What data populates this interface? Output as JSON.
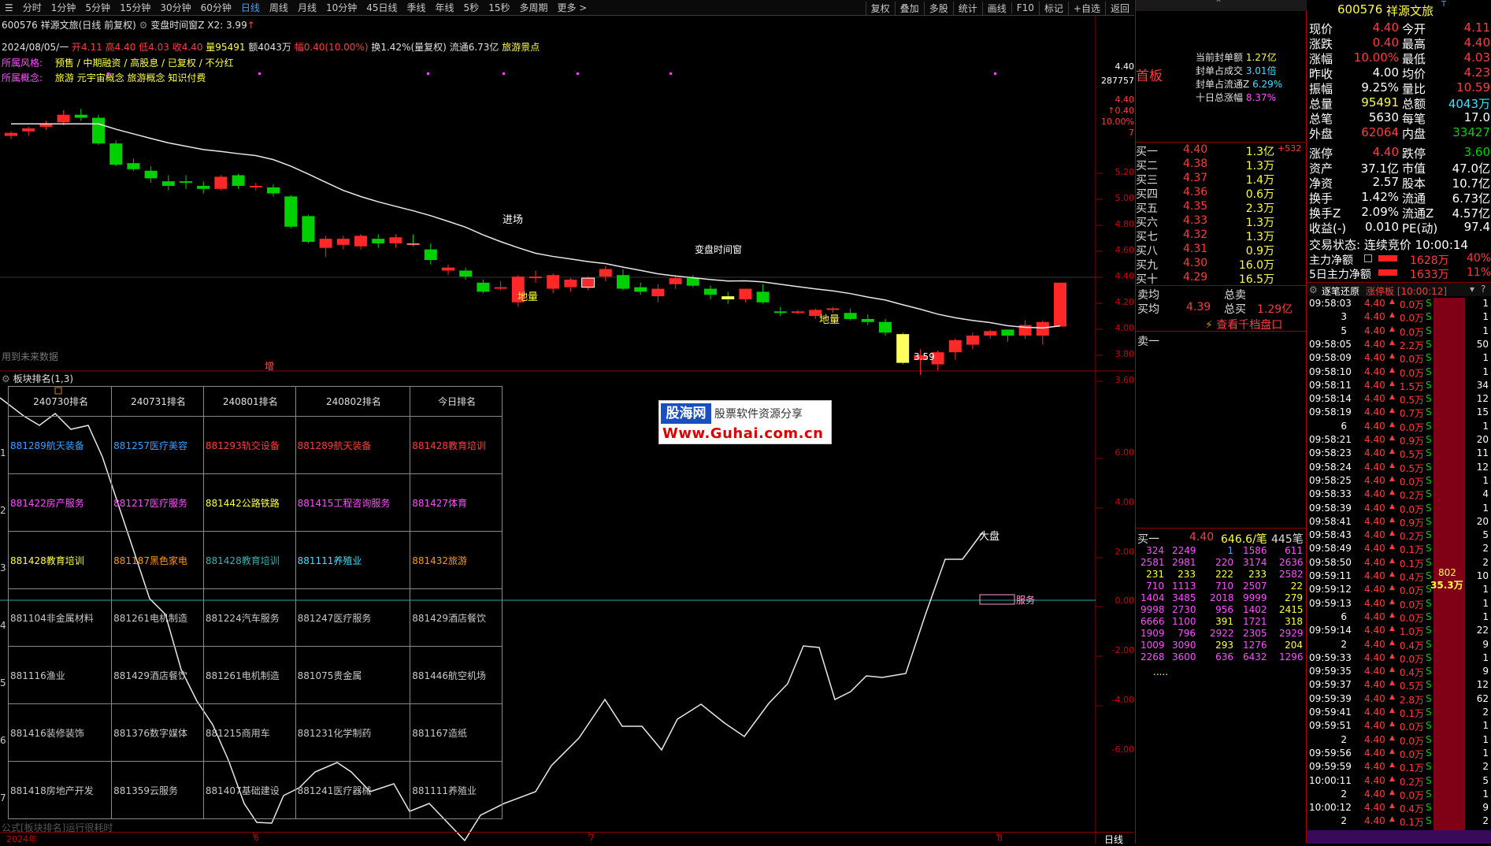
{
  "toolbar": {
    "left": [
      "☰",
      "分时",
      "1分钟",
      "5分钟",
      "15分钟",
      "30分钟",
      "60分钟",
      "日线",
      "周线",
      "月线",
      "10分钟",
      "45日线",
      "季线",
      "年线",
      "5秒",
      "15秒",
      "多周期",
      "更多 >"
    ],
    "right": [
      "复权",
      "叠加",
      "多股",
      "统计",
      "画线",
      "F10",
      "标记",
      "+自选",
      "返回"
    ]
  },
  "chart_title": "600576 祥源文旅(日线 前复权)",
  "indicator_title": "变盘时间窗Z X2: 3.99",
  "info": {
    "date": "2024/08/05/一",
    "open": "开4.11",
    "high": "高4.40",
    "low": "低4.03",
    "close": "收4.40",
    "volume": "量95491",
    "amount": "额4043万",
    "change": "幅0.40(10.00%)",
    "turnover": "换1.42%(量复权)",
    "float": "流通6.73亿",
    "concept_tag": "旅游景点"
  },
  "style_label": "所属风格:",
  "style_value": "预售 / 中期融资 / 高股息 / 已复权 / 不分红",
  "concept_label": "所属概念:",
  "concept_value": "旅游 元宇宙概念 旅游概念 知识付费",
  "main_labels": {
    "entry": "进场",
    "bottom1": "地量",
    "bottom2": "地量",
    "window": "变盘时间窗",
    "low": "3.59",
    "future": "用到未来数据",
    "add": "增"
  },
  "main_axis": [
    "4.40",
    "287757",
    "4.40",
    "↑0.40",
    "10.00%",
    "7",
    "5.20",
    "5.00",
    "4.80",
    "4.60",
    "4.40",
    "4.20",
    "4.00",
    "3.80",
    "3.60"
  ],
  "sub_title": "板块排名(1,3)",
  "watermark": {
    "line1": "股海网",
    "line2": "股票软件资源分享",
    "url": "Www.Guhai.com.cn"
  },
  "ranking": {
    "headers": [
      "240730排名",
      "240731排名",
      "240801排名",
      "240802排名",
      "今日排名"
    ],
    "rows": [
      [
        "881289航天装备",
        "881257医疗美容",
        "881293轨交设备",
        "881289航天装备",
        "881428教育培训"
      ],
      [
        "881422房产服务",
        "881217医疗服务",
        "881442公路铁路",
        "881415工程咨询服务",
        "881427体育"
      ],
      [
        "881428教育培训",
        "881187黑色家电",
        "881428教育培训",
        "881111养殖业",
        "881432旅游"
      ],
      [
        "881104非金属材料",
        "881261电机制造",
        "881224汽车服务",
        "881247医疗服务",
        "881429酒店餐饮"
      ],
      [
        "881116渔业",
        "881429酒店餐饮",
        "881261电机制造",
        "881075贵金属",
        "881446航空机场"
      ],
      [
        "881416装修装饰",
        "881376数字媒体",
        "881215商用车",
        "881231化学制药",
        "881167造纸"
      ],
      [
        "881418房地产开发",
        "881359云服务",
        "881407基础建设",
        "881241医疗器械",
        "881111养殖业"
      ]
    ]
  },
  "sub_axis": [
    "6.00",
    "4.00",
    "2.00",
    "0.00",
    "-2.00",
    "-4.00",
    "-6.00"
  ],
  "sub_labels": {
    "dapan": "大盘",
    "service": "服务",
    "formula": "公式[板块排名]运行很耗时"
  },
  "xaxis": {
    "year": "2024年",
    "m6": "6",
    "m7": "7",
    "m8": "8",
    "period": "日线"
  },
  "quote": {
    "code": "600576",
    "name": "祥源文旅",
    "pairs": [
      [
        "现价",
        "4.40",
        "今开",
        "4.11"
      ],
      [
        "涨跌",
        "0.40",
        "最高",
        "4.40"
      ],
      [
        "涨幅",
        "10.00%",
        "最低",
        "4.03"
      ],
      [
        "昨收",
        "4.00",
        "均价",
        "4.23"
      ],
      [
        "振幅",
        "9.25%",
        "量比",
        "10.59"
      ],
      [
        "总量",
        "95491",
        "总额",
        "4043万"
      ],
      [
        "总笔",
        "5630",
        "每笔",
        "17.0"
      ],
      [
        "外盘",
        "62064",
        "内盘",
        "33427"
      ],
      [
        "涨停",
        "4.40",
        "跌停",
        "3.60"
      ],
      [
        "资产",
        "37.1亿",
        "市值",
        "47.0亿"
      ],
      [
        "净资",
        "2.57",
        "股本",
        "10.7亿"
      ],
      [
        "换手",
        "1.42%",
        "流通",
        "6.73亿"
      ],
      [
        "换手Z",
        "2.09%",
        "流通Z",
        "4.57亿"
      ],
      [
        "收益(-)",
        "0.010",
        "PE(动)",
        "97.4"
      ]
    ],
    "trade_status": "交易状态: 连续竞价 10:00:14",
    "main_net": [
      "主力净额",
      "1628万",
      "40%"
    ],
    "main_net5": [
      "5日主力净额",
      "1633万",
      "11%"
    ]
  },
  "board": {
    "title": "首板",
    "items": [
      [
        "当前封单额",
        "1.27亿"
      ],
      [
        "封单占成交",
        "3.01倍"
      ],
      [
        "封单占流通Z",
        "6.29%"
      ],
      [
        "十日总涨幅",
        "8.37%"
      ]
    ]
  },
  "bids": [
    [
      "买一",
      "4.40",
      "1.3亿",
      "+532"
    ],
    [
      "买二",
      "4.38",
      "1.3万",
      ""
    ],
    [
      "买三",
      "4.37",
      "1.4万",
      ""
    ],
    [
      "买四",
      "4.36",
      "0.6万",
      ""
    ],
    [
      "买五",
      "4.35",
      "2.3万",
      ""
    ],
    [
      "买六",
      "4.33",
      "1.3万",
      ""
    ],
    [
      "买七",
      "4.32",
      "1.3万",
      ""
    ],
    [
      "买八",
      "4.31",
      "0.9万",
      ""
    ],
    [
      "买九",
      "4.30",
      "16.0万",
      ""
    ],
    [
      "买十",
      "4.29",
      "16.5万",
      ""
    ]
  ],
  "avg": {
    "sell_avg": "卖均",
    "total_sell": "总卖",
    "buy_avg": "买均",
    "buy_avg_val": "4.39",
    "total_buy": "总买",
    "total_buy_val": "1.29亿",
    "view_depth": "查看千档盘口",
    "sell1": "卖一"
  },
  "queue": {
    "head": [
      "买一",
      "4.40",
      "646.6/笔",
      "445笔"
    ],
    "rows": [
      [
        "324",
        "2249",
        "1",
        "1586",
        "611"
      ],
      [
        "2581",
        "2981",
        "220",
        "3174",
        "2636"
      ],
      [
        "231",
        "233",
        "222",
        "233",
        "2582"
      ],
      [
        "710",
        "1113",
        "710",
        "2507",
        "22"
      ],
      [
        "1404",
        "3485",
        "2018",
        "9999",
        "279"
      ],
      [
        "9998",
        "2730",
        "956",
        "1402",
        "2415"
      ],
      [
        "6666",
        "1100",
        "391",
        "1721",
        "318"
      ],
      [
        "1909",
        "796",
        "2922",
        "2305",
        "2929"
      ],
      [
        "1009",
        "3090",
        "293",
        "1276",
        "204"
      ],
      [
        "2268",
        "3600",
        "636",
        "6432",
        "1296"
      ]
    ],
    "more": "....."
  },
  "ticks_title": "逐笔还原",
  "ticks_tab": "涨停板 [10:00:12]",
  "ticks": [
    [
      "09:58:03",
      "4.40",
      "0.0万",
      "S",
      "1"
    ],
    [
      "3",
      "4.40",
      "0.0万",
      "S",
      "1"
    ],
    [
      "5",
      "4.40",
      "0.0万",
      "S",
      "1"
    ],
    [
      "09:58:05",
      "4.40",
      "2.2万",
      "S",
      "50"
    ],
    [
      "09:58:09",
      "4.40",
      "0.0万",
      "S",
      "1"
    ],
    [
      "09:58:10",
      "4.40",
      "0.0万",
      "S",
      "1"
    ],
    [
      "09:58:11",
      "4.40",
      "1.5万",
      "S",
      "34"
    ],
    [
      "09:58:14",
      "4.40",
      "0.5万",
      "S",
      "12"
    ],
    [
      "09:58:19",
      "4.40",
      "0.7万",
      "S",
      "15"
    ],
    [
      "6",
      "4.40",
      "0.0万",
      "S",
      "1"
    ],
    [
      "09:58:21",
      "4.40",
      "0.9万",
      "S",
      "20"
    ],
    [
      "09:58:23",
      "4.40",
      "0.5万",
      "S",
      "11"
    ],
    [
      "09:58:24",
      "4.40",
      "0.5万",
      "S",
      "12"
    ],
    [
      "09:58:25",
      "4.40",
      "0.0万",
      "S",
      "1"
    ],
    [
      "09:58:33",
      "4.40",
      "0.2万",
      "S",
      "4"
    ],
    [
      "09:58:39",
      "4.40",
      "0.0万",
      "S",
      "1"
    ],
    [
      "09:58:41",
      "4.40",
      "0.9万",
      "S",
      "20"
    ],
    [
      "09:58:43",
      "4.40",
      "0.2万",
      "S",
      "5"
    ],
    [
      "09:58:49",
      "4.40",
      "0.1万",
      "S",
      "2"
    ],
    [
      "09:58:50",
      "4.40",
      "0.1万",
      "S",
      "2"
    ],
    [
      "09:59:11",
      "4.40",
      "0.4万",
      "S",
      "10"
    ],
    [
      "09:59:12",
      "4.40",
      "0.0万",
      "S",
      "1"
    ],
    [
      "09:59:13",
      "4.40",
      "0.0万",
      "S",
      "1"
    ],
    [
      "6",
      "4.40",
      "0.0万",
      "S",
      "1"
    ],
    [
      "09:59:14",
      "4.40",
      "1.0万",
      "S",
      "22"
    ],
    [
      "2",
      "4.40",
      "0.4万",
      "S",
      "9"
    ],
    [
      "09:59:33",
      "4.40",
      "0.0万",
      "S",
      "1"
    ],
    [
      "09:59:35",
      "4.40",
      "0.4万",
      "S",
      "9"
    ],
    [
      "09:59:37",
      "4.40",
      "0.5万",
      "S",
      "12"
    ],
    [
      "09:59:39",
      "4.40",
      "2.8万",
      "S",
      "62"
    ],
    [
      "09:59:41",
      "4.40",
      "0.1万",
      "S",
      "2"
    ],
    [
      "09:59:51",
      "4.40",
      "0.0万",
      "S",
      "1"
    ],
    [
      "2",
      "4.40",
      "0.0万",
      "S",
      "1"
    ],
    [
      "09:59:56",
      "4.40",
      "0.0万",
      "S",
      "1"
    ],
    [
      "09:59:59",
      "4.40",
      "0.1万",
      "S",
      "2"
    ],
    [
      "10:00:11",
      "4.40",
      "0.2万",
      "S",
      "5"
    ],
    [
      "2",
      "4.40",
      "0.0万",
      "S",
      "1"
    ],
    [
      "10:00:12",
      "4.40",
      "0.4万",
      "S",
      "9"
    ],
    [
      "2",
      "4.40",
      "0.1万",
      "S",
      "2"
    ]
  ],
  "big_order": [
    "802",
    "35.3万"
  ]
}
